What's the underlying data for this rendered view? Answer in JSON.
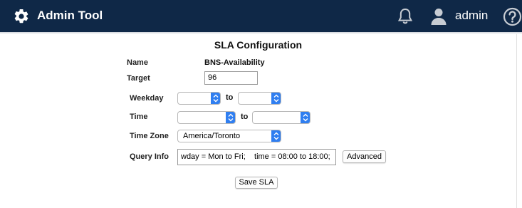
{
  "header": {
    "app_title": "Admin Tool",
    "username": "admin",
    "icons": {
      "menu": "gear-icon",
      "notifications": "bell-icon",
      "user": "user-icon",
      "help": "help-icon"
    },
    "background_color": "#0f2847"
  },
  "form": {
    "title": "SLA Configuration",
    "name": {
      "label": "Name",
      "value": "BNS-Availability"
    },
    "target": {
      "label": "Target",
      "value": "96"
    },
    "weekday": {
      "label": "Weekday",
      "from_value": "",
      "to_label": "to",
      "to_value": ""
    },
    "time": {
      "label": "Time",
      "from_value": "",
      "to_label": "to",
      "to_value": ""
    },
    "time_zone": {
      "label": "Time Zone",
      "value": "America/Toronto"
    },
    "query_info": {
      "label": "Query Info",
      "value": "wday = Mon to Fri;    time = 08:00 to 18:00;",
      "advanced_label": "Advanced"
    },
    "save_label": "Save SLA",
    "accent_color": "#2f7ef0"
  }
}
